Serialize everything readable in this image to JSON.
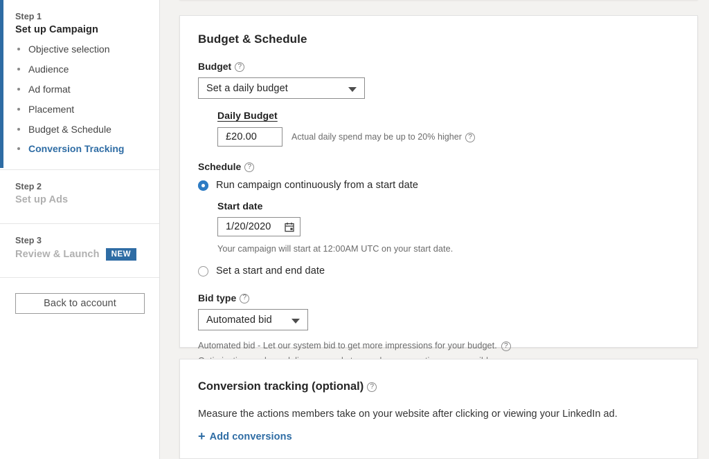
{
  "sidebar": {
    "step1": {
      "label": "Step 1",
      "title": "Set up Campaign",
      "items": [
        {
          "label": "Objective selection",
          "active": false
        },
        {
          "label": "Audience",
          "active": false
        },
        {
          "label": "Ad format",
          "active": false
        },
        {
          "label": "Placement",
          "active": false
        },
        {
          "label": "Budget & Schedule",
          "active": false
        },
        {
          "label": "Conversion Tracking",
          "active": true
        }
      ]
    },
    "step2": {
      "label": "Step 2",
      "title": "Set up Ads"
    },
    "step3": {
      "label": "Step 3",
      "title": "Review & Launch",
      "badge": "NEW"
    },
    "back_button": "Back to account"
  },
  "budget_card": {
    "title": "Budget & Schedule",
    "budget_label": "Budget",
    "budget_select_value": "Set a daily budget",
    "daily_budget_label": "Daily Budget",
    "daily_budget_value": "£20.00",
    "daily_budget_hint": "Actual daily spend may be up to 20% higher",
    "schedule_label": "Schedule",
    "radio_continuous": "Run campaign continuously from a start date",
    "start_date_label": "Start date",
    "start_date_value": "1/20/2020",
    "start_date_note": "Your campaign will start at 12:00AM UTC on your start date.",
    "radio_start_end": "Set a start and end date",
    "bid_type_label": "Bid type",
    "bid_select_value": "Automated bid",
    "bid_note_line1": "Automated bid - Let our system bid to get more impressions for your budget.",
    "bid_note_line2": "Optimization goal: we deliver your ads to people as many times as possible."
  },
  "conversion_card": {
    "title": "Conversion tracking (optional)",
    "description": "Measure the actions members take on your website after clicking or viewing your LinkedIn ad.",
    "add_link": "Add conversions",
    "plus_glyph": "+"
  },
  "icons": {
    "help": "?"
  },
  "colors": {
    "accent": "#2e6ca4",
    "radio_selected": "#2e7cc4",
    "page_bg": "#f3f2f0"
  }
}
